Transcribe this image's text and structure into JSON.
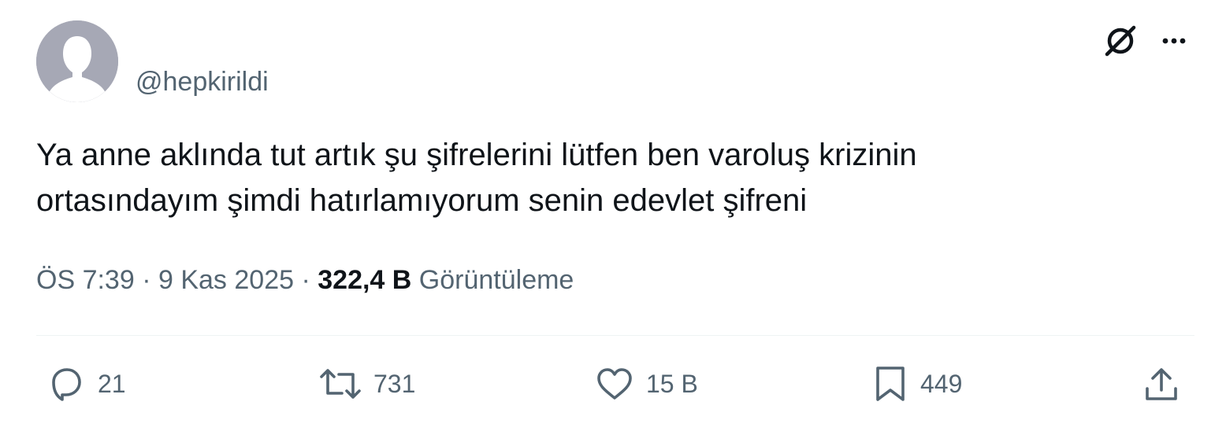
{
  "author": {
    "handle": "@hepkirildi"
  },
  "tweet": {
    "text_lines": [
      "Ya anne aklında tut artık şu şifrelerini lütfen ben varoluş krizinin",
      "ortasındayım şimdi hatırlamıyorum senin edevlet şifreni"
    ],
    "time": "ÖS 7:39",
    "separator": "·",
    "date": "9 Kas 2025",
    "views_count": "322,4 B",
    "views_label": "Görüntüleme"
  },
  "actions": {
    "replies": "21",
    "retweets": "731",
    "likes": "15 B",
    "bookmarks": "449"
  },
  "icons": {
    "top_right": [
      "grok-icon",
      "more-icon"
    ],
    "action_bar": [
      "reply-icon",
      "retweet-icon",
      "like-icon",
      "bookmark-icon",
      "share-icon"
    ]
  },
  "colors": {
    "text_primary": "#0f1419",
    "text_secondary": "#536471",
    "divider": "#eff3f4",
    "avatar_bg": "#a6a8b5"
  }
}
